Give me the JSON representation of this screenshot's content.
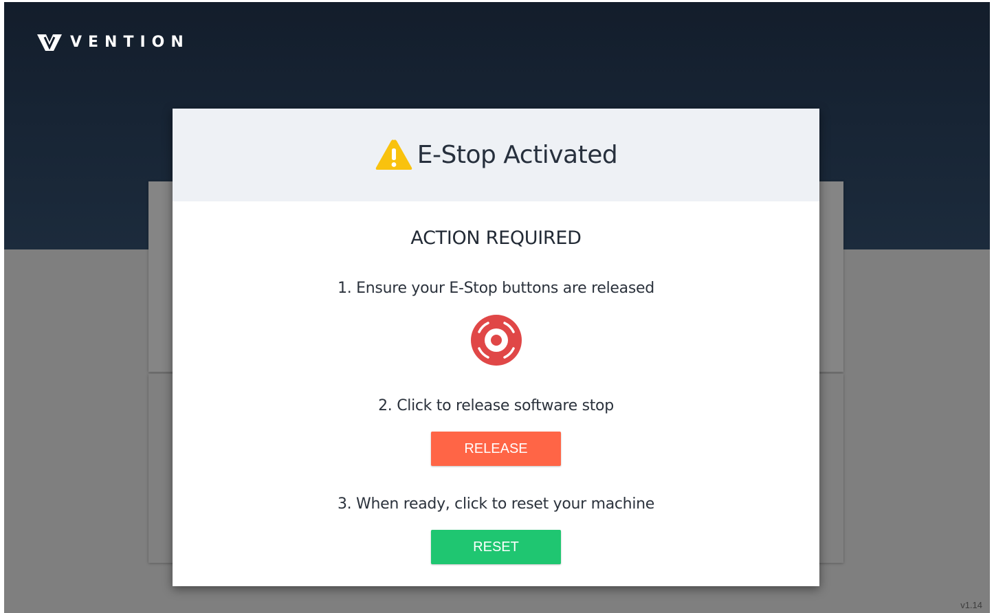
{
  "brand": {
    "name": "VENTION",
    "icon": "vention-logo-icon"
  },
  "version": "v1.14",
  "modal": {
    "title": "E-Stop Activated",
    "title_icon": "warning-icon",
    "heading": "ACTION REQUIRED",
    "steps": [
      "1. Ensure your E-Stop buttons are released",
      "2. Click to release software stop",
      "3. When ready, click to reset your machine"
    ],
    "estop_icon": "estop-button-icon",
    "release_label": "RELEASE",
    "reset_label": "RESET"
  },
  "colors": {
    "header_dark": "#131d2b",
    "backdrop": "#7f7f7f",
    "warning": "#f9c20e",
    "estop_red": "#e04747",
    "release_button": "#ff6546",
    "reset_button": "#1fc671"
  }
}
